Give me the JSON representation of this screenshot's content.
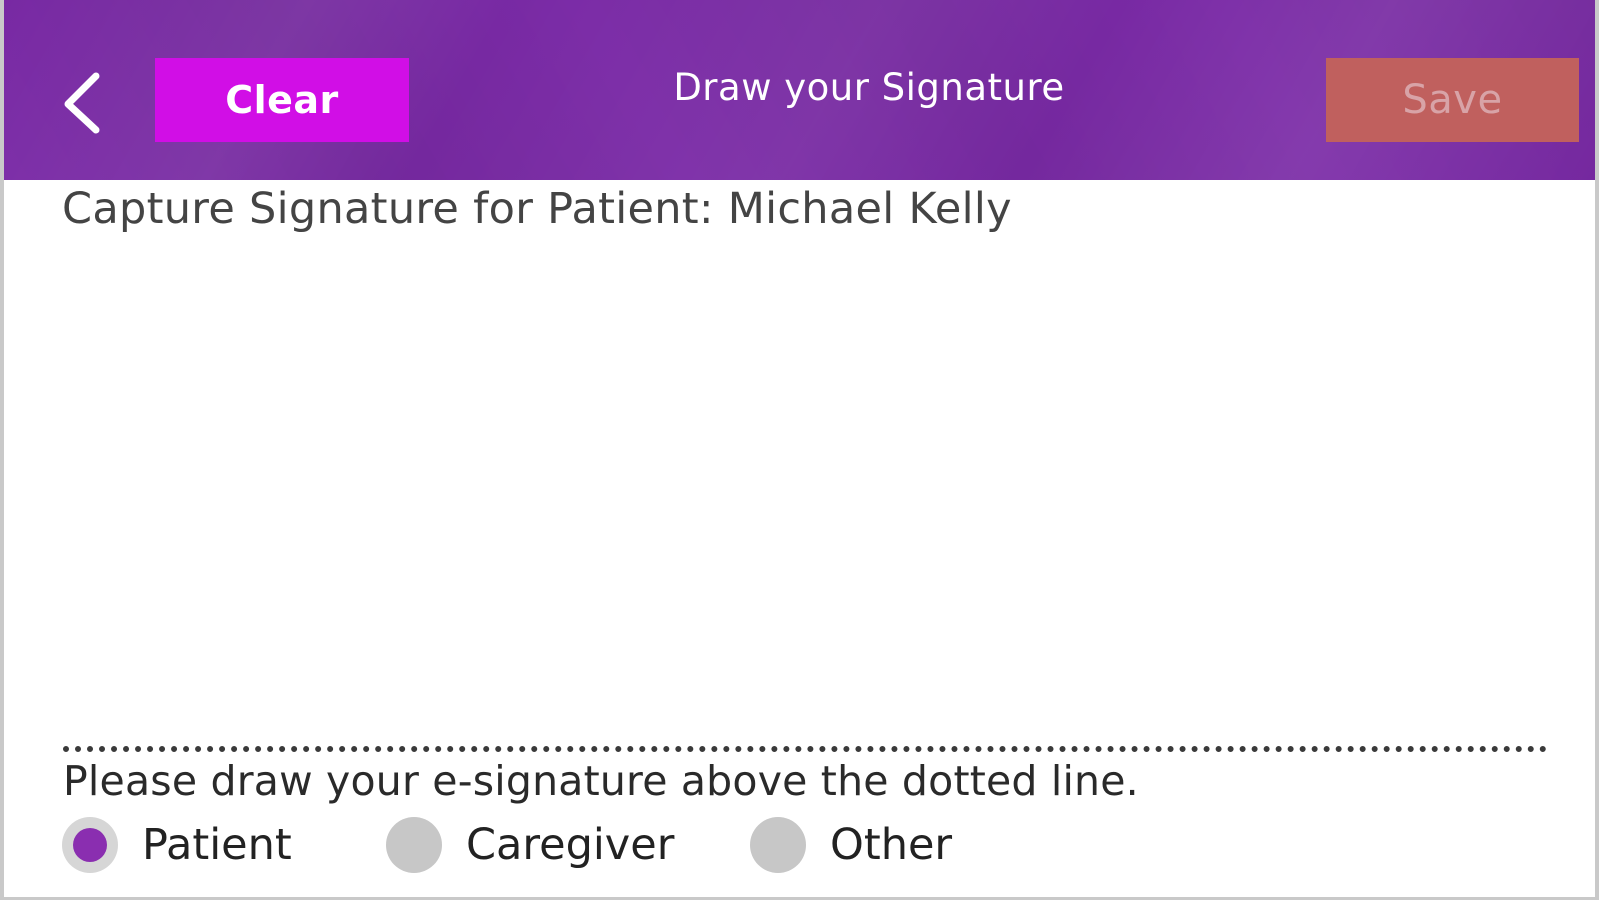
{
  "header": {
    "back_icon": "chevron-left-icon",
    "clear_label": "Clear",
    "title": "Draw your Signature",
    "save_label": "Save"
  },
  "main": {
    "capture_label": "Capture Signature for Patient: Michael Kelly",
    "instruction": "Please draw your e-signature above the dotted line.",
    "roles": [
      {
        "label": "Patient",
        "selected": true
      },
      {
        "label": "Caregiver",
        "selected": false
      },
      {
        "label": "Other",
        "selected": false
      }
    ]
  },
  "colors": {
    "header_bg": "#7a2aa6",
    "clear_bg": "#d10ee6",
    "save_bg": "#c0605e",
    "radio_selected": "#8a2eb0",
    "radio_unselected": "#c7c7c7"
  }
}
